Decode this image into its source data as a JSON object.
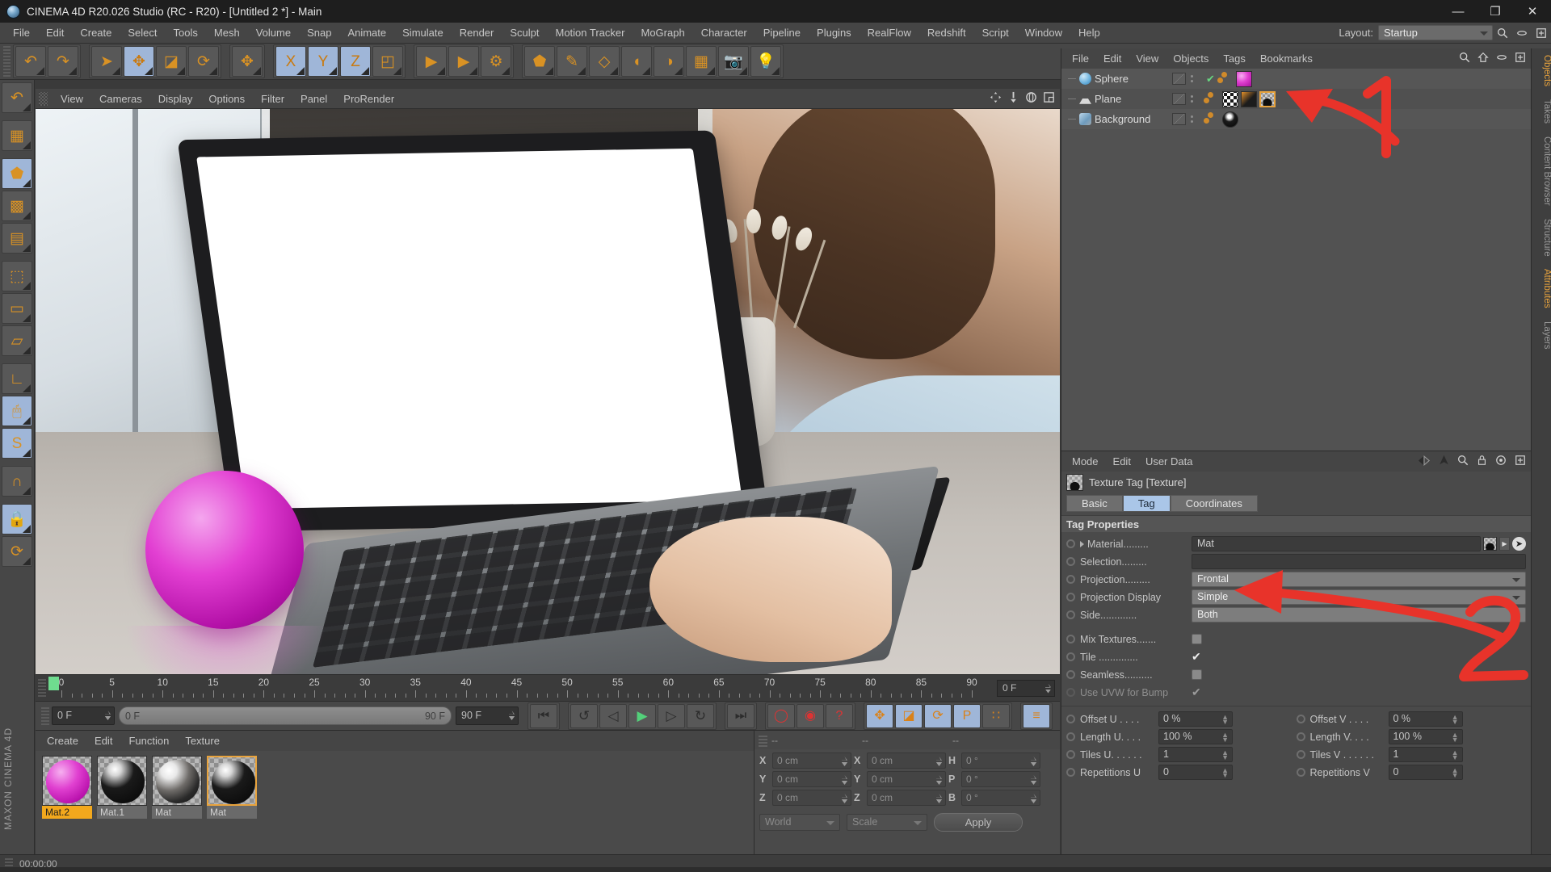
{
  "titlebar": {
    "title": "CINEMA 4D R20.026 Studio (RC - R20) - [Untitled 2 *] - Main",
    "minimize": "—",
    "maximize": "❐",
    "close": "✕",
    "logo_icon": "c4d-logo-icon"
  },
  "menubar": {
    "items": [
      "File",
      "Edit",
      "Create",
      "Select",
      "Tools",
      "Mesh",
      "Volume",
      "Snap",
      "Animate",
      "Simulate",
      "Render",
      "Sculpt",
      "Motion Tracker",
      "MoGraph",
      "Character",
      "Pipeline",
      "Plugins",
      "RealFlow",
      "Redshift",
      "Script",
      "Window",
      "Help"
    ],
    "layout_label": "Layout:",
    "layout_value": "Startup"
  },
  "toolbar": {
    "groups": [
      {
        "buttons": [
          {
            "name": "undo-button",
            "glyph": "↶",
            "active": false
          },
          {
            "name": "redo-button",
            "glyph": "↷",
            "active": false
          }
        ]
      },
      {
        "buttons": [
          {
            "name": "live-selection-tool",
            "glyph": "➤",
            "active": false
          },
          {
            "name": "move-tool",
            "glyph": "✥",
            "active": true
          },
          {
            "name": "scale-tool",
            "glyph": "◪",
            "active": false
          },
          {
            "name": "rotate-tool",
            "glyph": "⟳",
            "active": false
          }
        ]
      },
      {
        "buttons": [
          {
            "name": "move-axis-tool",
            "glyph": "✥",
            "active": false
          }
        ]
      },
      {
        "buttons": [
          {
            "name": "x-axis-lock",
            "glyph": "X",
            "active": true
          },
          {
            "name": "y-axis-lock",
            "glyph": "Y",
            "active": true
          },
          {
            "name": "z-axis-lock",
            "glyph": "Z",
            "active": true
          },
          {
            "name": "world-object-coord",
            "glyph": "◰",
            "active": false
          }
        ]
      },
      {
        "buttons": [
          {
            "name": "render-view-button",
            "glyph": "▶",
            "active": false
          },
          {
            "name": "render-region-button",
            "glyph": "▶",
            "active": false
          },
          {
            "name": "render-settings-button",
            "glyph": "⚙",
            "active": false
          }
        ]
      },
      {
        "buttons": [
          {
            "name": "cube-primitive-button",
            "glyph": "⬟",
            "active": false
          },
          {
            "name": "spline-pen-button",
            "glyph": "✎",
            "active": false
          },
          {
            "name": "array-generator-button",
            "glyph": "◇",
            "active": false
          },
          {
            "name": "bend-deformer-button",
            "glyph": "◖",
            "active": false
          },
          {
            "name": "environment-button",
            "glyph": "◑",
            "active": false
          },
          {
            "name": "floor-button",
            "glyph": "▦",
            "active": false
          },
          {
            "name": "camera-button",
            "glyph": "📷",
            "active": false
          },
          {
            "name": "light-button",
            "glyph": "💡",
            "active": false
          }
        ]
      }
    ]
  },
  "left_toolbar": {
    "buttons": [
      {
        "name": "undo-tool-button",
        "glyph": "↶",
        "active": false
      },
      {
        "name": "make-editable-button",
        "glyph": "▦",
        "active": false
      },
      {
        "name": "model-mode-button",
        "glyph": "⬟",
        "active": true
      },
      {
        "name": "texture-mode-button",
        "glyph": "▩",
        "active": false
      },
      {
        "name": "workplane-mode-button",
        "glyph": "▤",
        "active": false
      },
      {
        "name": "points-mode-button",
        "glyph": "⬚",
        "active": false
      },
      {
        "name": "edges-mode-button",
        "glyph": "▭",
        "active": false
      },
      {
        "name": "polygons-mode-button",
        "glyph": "▱",
        "active": false
      },
      {
        "name": "axis-mode-button",
        "glyph": "∟",
        "active": false
      },
      {
        "name": "enable-snap-button",
        "glyph": "🖱",
        "active": true
      },
      {
        "name": "soft-selection-button",
        "glyph": "S",
        "active": true
      },
      {
        "name": "magnet-tool-button",
        "glyph": "∩",
        "active": false
      },
      {
        "name": "lock-workplane-button",
        "glyph": "🔒",
        "active": true
      },
      {
        "name": "planar-workplane-button",
        "glyph": "⟳",
        "active": false
      }
    ],
    "brand_line1": "MAXON",
    "brand_line2": "CINEMA 4D"
  },
  "viewport": {
    "menus": [
      "View",
      "Cameras",
      "Display",
      "Options",
      "Filter",
      "Panel",
      "ProRender"
    ],
    "nav_icons": [
      "pan-icon",
      "zoom-icon",
      "rotate-icon",
      "maximize-viewport-icon"
    ]
  },
  "timeline": {
    "current_frame_field": "0 F",
    "ticks": [
      0,
      5,
      10,
      15,
      20,
      25,
      30,
      35,
      40,
      45,
      50,
      55,
      60,
      65,
      70,
      75,
      80,
      85,
      90
    ],
    "max_frame": 90
  },
  "transport": {
    "start_field": "0 F",
    "range_min": "0 F",
    "range_max": "90 F",
    "end_field": "90 F",
    "buttons": [
      {
        "name": "go-to-start-button",
        "glyph": "⏮"
      },
      {
        "name": "previous-key-button",
        "glyph": "↺"
      },
      {
        "name": "step-back-button",
        "glyph": "◁"
      },
      {
        "name": "play-button",
        "glyph": "▶"
      },
      {
        "name": "step-forward-button",
        "glyph": "▷"
      },
      {
        "name": "next-key-button",
        "glyph": "↻"
      },
      {
        "name": "go-to-end-button",
        "glyph": "⏭"
      }
    ],
    "record_group": [
      {
        "name": "autokeying-button",
        "glyph": "◯",
        "active": false
      },
      {
        "name": "record-active-objects-button",
        "glyph": "◉",
        "active": false
      },
      {
        "name": "parameter-keys-button",
        "glyph": "?",
        "active": false
      }
    ],
    "key_group": [
      {
        "name": "record-position-button",
        "glyph": "✥",
        "active": true
      },
      {
        "name": "record-scale-button",
        "glyph": "◪",
        "active": true
      },
      {
        "name": "record-rotation-button",
        "glyph": "⟳",
        "active": true
      },
      {
        "name": "record-pla-button",
        "glyph": "P",
        "active": true
      },
      {
        "name": "record-point-level-button",
        "glyph": "∷",
        "active": false
      }
    ],
    "extra_group": [
      {
        "name": "keyframe-selection-button",
        "glyph": "≡",
        "active": true
      }
    ]
  },
  "material_manager": {
    "menus": [
      "Create",
      "Edit",
      "Function",
      "Texture"
    ],
    "materials": [
      {
        "name": "Mat.2",
        "selected_label": true,
        "selected_border": false,
        "kind": "magenta"
      },
      {
        "name": "Mat.1",
        "selected_label": false,
        "selected_border": false,
        "kind": "dark"
      },
      {
        "name": "Mat",
        "selected_label": false,
        "selected_border": false,
        "kind": "photo"
      },
      {
        "name": "Mat",
        "selected_label": false,
        "selected_border": true,
        "kind": "dark"
      }
    ]
  },
  "coordinates": {
    "headers": [
      "--",
      "--",
      "--"
    ],
    "rows": [
      {
        "axis1": "X",
        "val1": "0 cm",
        "axis2": "X",
        "val2": "0 cm",
        "axis3": "H",
        "val3": "0 °"
      },
      {
        "axis1": "Y",
        "val1": "0 cm",
        "axis2": "Y",
        "val2": "0 cm",
        "axis3": "P",
        "val3": "0 °"
      },
      {
        "axis1": "Z",
        "val1": "0 cm",
        "axis2": "Z",
        "val2": "0 cm",
        "axis3": "B",
        "val3": "0 °"
      }
    ],
    "coord_system": "World",
    "mode": "Scale",
    "apply_label": "Apply"
  },
  "object_manager": {
    "menus": [
      "File",
      "Edit",
      "View",
      "Objects",
      "Tags",
      "Bookmarks"
    ],
    "header_icons": [
      "search-icon",
      "home-icon",
      "eye-icon",
      "expand-icon"
    ],
    "objects": [
      {
        "name": "Sphere",
        "icon": "sphere-object-icon",
        "checked": true,
        "tags": [
          {
            "name": "material-tag-magenta",
            "highlight": false
          }
        ]
      },
      {
        "name": "Plane",
        "icon": "plane-object-icon",
        "checked": false,
        "tags": [
          {
            "name": "material-tag-checker",
            "highlight": false
          },
          {
            "name": "animation-tag",
            "highlight": false
          },
          {
            "name": "texture-tag-photo",
            "highlight": true
          }
        ]
      },
      {
        "name": "Background",
        "icon": "background-object-icon",
        "checked": false,
        "tags": [
          {
            "name": "material-tag-photo",
            "highlight": false
          }
        ]
      }
    ]
  },
  "right_dock": {
    "tabs": [
      {
        "label": "Objects",
        "active": true
      },
      {
        "label": "Takes",
        "active": false
      },
      {
        "label": "Content Browser",
        "active": false
      },
      {
        "label": "Structure",
        "active": false
      },
      {
        "label": "Attributes",
        "active": true
      },
      {
        "label": "Layers",
        "active": false
      }
    ]
  },
  "attribute_manager": {
    "menus": [
      "Mode",
      "Edit",
      "User Data"
    ],
    "header_icons": [
      "back-arrow-icon",
      "forward-arrow-icon",
      "up-arrow-icon",
      "search-icon",
      "lock-icon",
      "target-icon",
      "expand-icon"
    ],
    "object_icon": "texture-tag-icon",
    "object_title": "Texture Tag [Texture]",
    "tabs": [
      {
        "label": "Basic",
        "active": false
      },
      {
        "label": "Tag",
        "active": true
      },
      {
        "label": "Coordinates",
        "active": false
      }
    ],
    "section_title": "Tag Properties",
    "fields": [
      {
        "label": "Material.........",
        "type": "text",
        "value": "Mat",
        "has_arrow": true
      },
      {
        "label": "Selection.........",
        "type": "text",
        "value": ""
      },
      {
        "label": "Projection.........",
        "type": "dropdown",
        "value": "Frontal"
      },
      {
        "label": "Projection Display",
        "type": "dropdown",
        "value": "Simple"
      },
      {
        "label": "Side.............",
        "type": "dropdown",
        "value": "Both"
      }
    ],
    "checkboxes": [
      {
        "label": "Mix Textures.......",
        "checked": false,
        "disabled": false
      },
      {
        "label": "Tile ..............",
        "checked": true,
        "disabled": false
      },
      {
        "label": "Seamless..........",
        "checked": false,
        "disabled": false
      },
      {
        "label": "Use UVW for Bump",
        "checked": true,
        "disabled": true
      }
    ],
    "numeric_left": [
      {
        "label": "Offset U . . . .",
        "value": "0 %"
      },
      {
        "label": "Length U. . . .",
        "value": "100 %"
      },
      {
        "label": "Tiles U. . . . . .",
        "value": "1"
      },
      {
        "label": "Repetitions U",
        "value": "0"
      }
    ],
    "numeric_right": [
      {
        "label": "Offset V . . . .",
        "value": "0 %"
      },
      {
        "label": "Length V. . . .",
        "value": "100 %"
      },
      {
        "label": "Tiles V . . . . . .",
        "value": "1"
      },
      {
        "label": "Repetitions V",
        "value": "0"
      }
    ]
  },
  "statusbar": {
    "time": "00:00:00"
  },
  "annotations": [
    {
      "label": "1",
      "name": "annotation-number-1",
      "color": "#e8332a"
    },
    {
      "label": "2",
      "name": "annotation-number-2",
      "color": "#e8332a"
    }
  ]
}
